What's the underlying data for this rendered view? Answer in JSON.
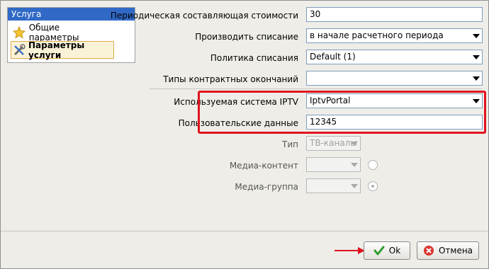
{
  "tree": {
    "header": "Услуга",
    "items": [
      {
        "label": "Общие параметры",
        "icon": "star-icon"
      },
      {
        "label": "Параметры услуги",
        "icon": "tools-icon"
      }
    ]
  },
  "form": {
    "periodic_cost": {
      "label": "Периодическая составляющая стоимости",
      "value": "30"
    },
    "write_off": {
      "label": "Производить списание",
      "value": "в начале расчетного периода"
    },
    "write_off_policy": {
      "label": "Политика списания",
      "value": "Default (1)"
    },
    "contract_endings": {
      "label": "Типы контрактных окончаний",
      "value": ""
    },
    "iptv_system": {
      "label": "Используемая система IPTV",
      "value": "IptvPortal"
    },
    "user_data": {
      "label": "Пользовательские данные",
      "value": "12345"
    },
    "type": {
      "label": "Тип",
      "value": "ТВ-каналы"
    },
    "media_content": {
      "label": "Медиа-контент",
      "value": ""
    },
    "media_group": {
      "label": "Медиа-группа",
      "value": ""
    }
  },
  "buttons": {
    "ok": "Ok",
    "cancel": "Отмена"
  },
  "colors": {
    "highlight": "#e0141e",
    "tree_header": "#3169c6",
    "selected_item": "#fbf3d8"
  }
}
